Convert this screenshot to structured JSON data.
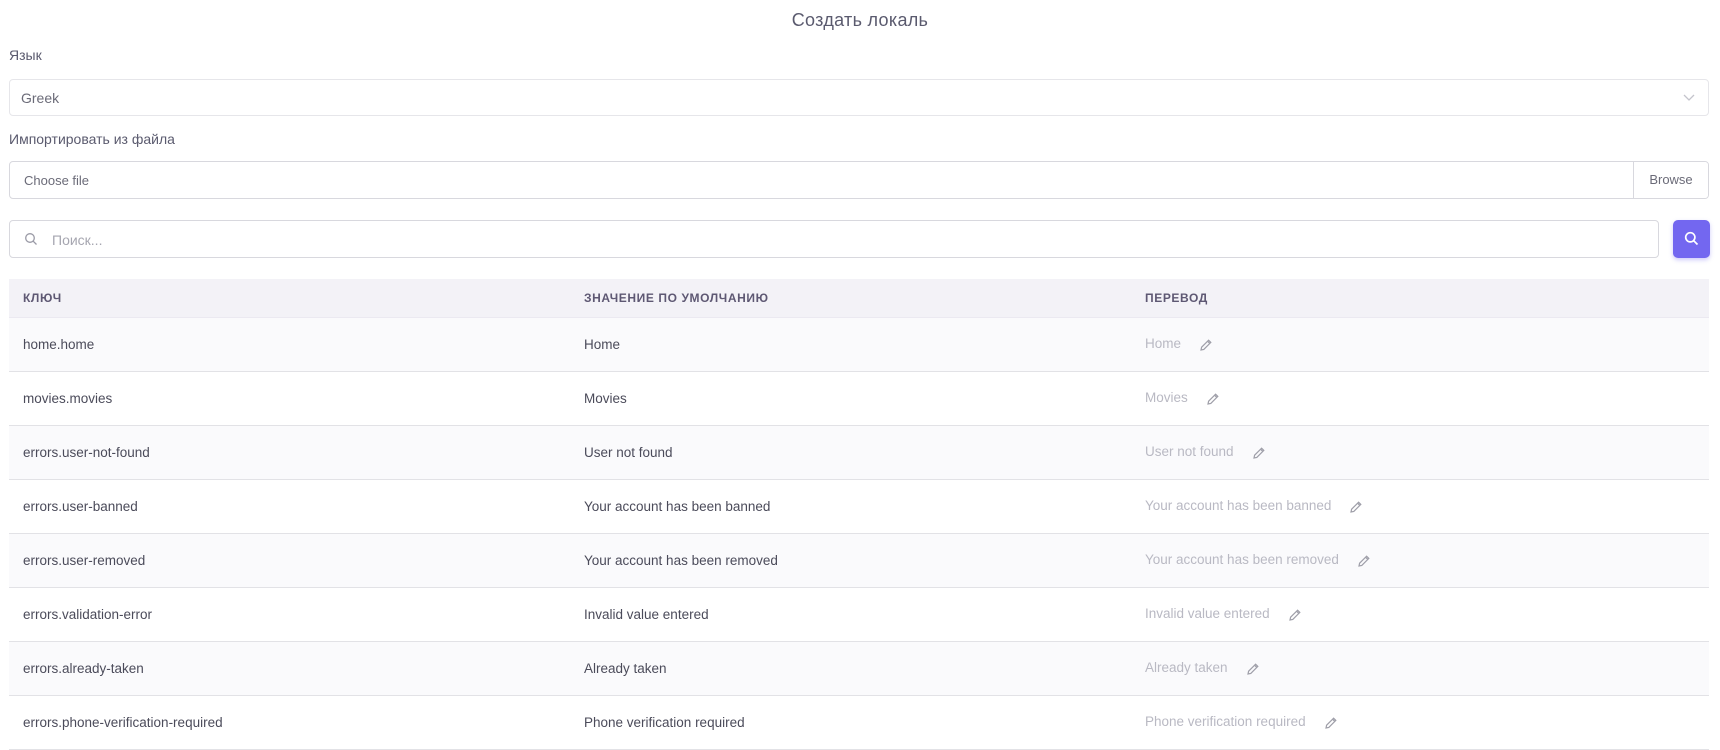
{
  "page": {
    "title": "Создать локаль"
  },
  "language": {
    "label": "Язык",
    "value": "Greek",
    "icon": "chevron-down-icon"
  },
  "import": {
    "label": "Импортировать из файла",
    "placeholder": "Choose file",
    "browse_label": "Browse"
  },
  "search": {
    "placeholder": "Поиск...",
    "icon": "search-icon",
    "button_icon": "search-icon"
  },
  "colors": {
    "accent": "#7367f0",
    "header_bg": "#f3f2f7",
    "muted_text": "#b9b9c3"
  },
  "table": {
    "headers": [
      "Ключ",
      "Значение по умолчанию",
      "Перевод"
    ],
    "rows": [
      {
        "key": "home.home",
        "default": "Home",
        "translation": "Home"
      },
      {
        "key": "movies.movies",
        "default": "Movies",
        "translation": "Movies"
      },
      {
        "key": "errors.user-not-found",
        "default": "User not found",
        "translation": "User not found"
      },
      {
        "key": "errors.user-banned",
        "default": "Your account has been banned",
        "translation": "Your account has been banned"
      },
      {
        "key": "errors.user-removed",
        "default": "Your account has been removed",
        "translation": "Your account has been removed"
      },
      {
        "key": "errors.validation-error",
        "default": "Invalid value entered",
        "translation": "Invalid value entered"
      },
      {
        "key": "errors.already-taken",
        "default": "Already taken",
        "translation": "Already taken"
      },
      {
        "key": "errors.phone-verification-required",
        "default": "Phone verification required",
        "translation": "Phone verification required"
      }
    ]
  }
}
